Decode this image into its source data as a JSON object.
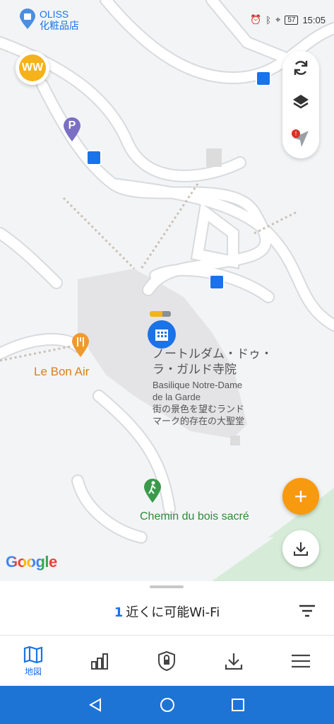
{
  "status_bar": {
    "time": "15:05",
    "battery": "57",
    "shop_label_line1": "OLISS",
    "shop_label_line2": "化粧品店"
  },
  "wifi_logo": {
    "text": "WW"
  },
  "map_controls": {
    "refresh_icon": "refresh-icon",
    "layers_icon": "layers-icon",
    "location_icon": "location-arrow-icon",
    "alert_badge": "!"
  },
  "map": {
    "poi_landmark": {
      "name_line1": "ノートルダム・ドゥ・",
      "name_line2": "ラ・ガルド寺院",
      "sub_line1": "Basilique Notre-Dame",
      "sub_line2": "de la Garde",
      "desc_line1": "街の景色を望むランド",
      "desc_line2": "マーク的存在の大聖堂"
    },
    "poi_restaurant": "Le Bon Air",
    "poi_trail": "Chemin du bois sacré",
    "parking_label": "P",
    "google_logo": "Google"
  },
  "fab": {
    "add_label": "+"
  },
  "bottom_sheet": {
    "count": "1",
    "title": "近くに可能Wi-Fi"
  },
  "bottom_nav": {
    "map_label": "地図"
  },
  "colors": {
    "accent": "#1a73e8",
    "orange": "#f79a0f",
    "system_bar": "#1e74d4",
    "trail_green": "#2e8b3a",
    "restaurant_orange": "#d9811a"
  }
}
